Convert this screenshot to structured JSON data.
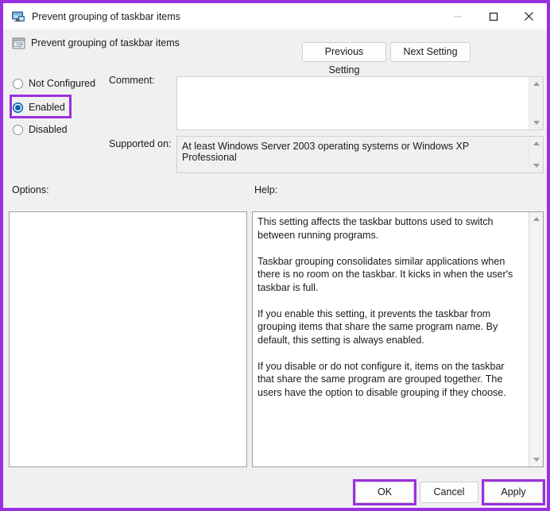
{
  "window": {
    "title": "Prevent grouping of taskbar items",
    "title_icon": "computer-monitor-icon",
    "minimize_label": "—",
    "maximize_label": "□",
    "close_label": "✕"
  },
  "policy": {
    "icon": "policy-setting-icon",
    "name": "Prevent grouping of taskbar items"
  },
  "nav": {
    "previous_label": "Previous Setting",
    "next_label": "Next Setting"
  },
  "state_options": [
    {
      "id": "not-configured",
      "label": "Not Configured",
      "selected": false
    },
    {
      "id": "enabled",
      "label": "Enabled",
      "selected": true
    },
    {
      "id": "disabled",
      "label": "Disabled",
      "selected": false
    }
  ],
  "comment": {
    "label": "Comment:",
    "value": "",
    "scroll_up_icon": "triangle-up-icon",
    "scroll_down_icon": "triangle-down-icon"
  },
  "supported_on": {
    "label": "Supported on:",
    "value": "At least Windows Server 2003 operating systems or Windows XP Professional",
    "scroll_up_icon": "triangle-up-icon",
    "scroll_down_icon": "triangle-down-icon"
  },
  "options": {
    "label": "Options:",
    "value": ""
  },
  "help": {
    "label": "Help:",
    "text": "This setting affects the taskbar buttons used to switch between running programs.\n\nTaskbar grouping consolidates similar applications when there is no room on the taskbar. It kicks in when the user's taskbar is full.\n\nIf you enable this setting, it prevents the taskbar from grouping items that share the same program name. By default, this setting is always enabled.\n\nIf you disable or do not configure it, items on the taskbar that share the same program are grouped together. The users have the option to disable grouping if they choose.",
    "scroll_up_icon": "triangle-up-icon",
    "scroll_down_icon": "triangle-down-icon"
  },
  "footer": {
    "ok_label": "OK",
    "cancel_label": "Cancel",
    "apply_label": "Apply"
  },
  "annotations": {
    "highlight_color": "#9b30e0",
    "highlighted": [
      "enabled-radio",
      "ok-button",
      "apply-button",
      "window-border"
    ]
  },
  "colors": {
    "accent_radio": "#0a64ad",
    "dialog_background": "#f0f0f0",
    "panel_background": "#ffffff",
    "highlight": "#9b30e0"
  }
}
